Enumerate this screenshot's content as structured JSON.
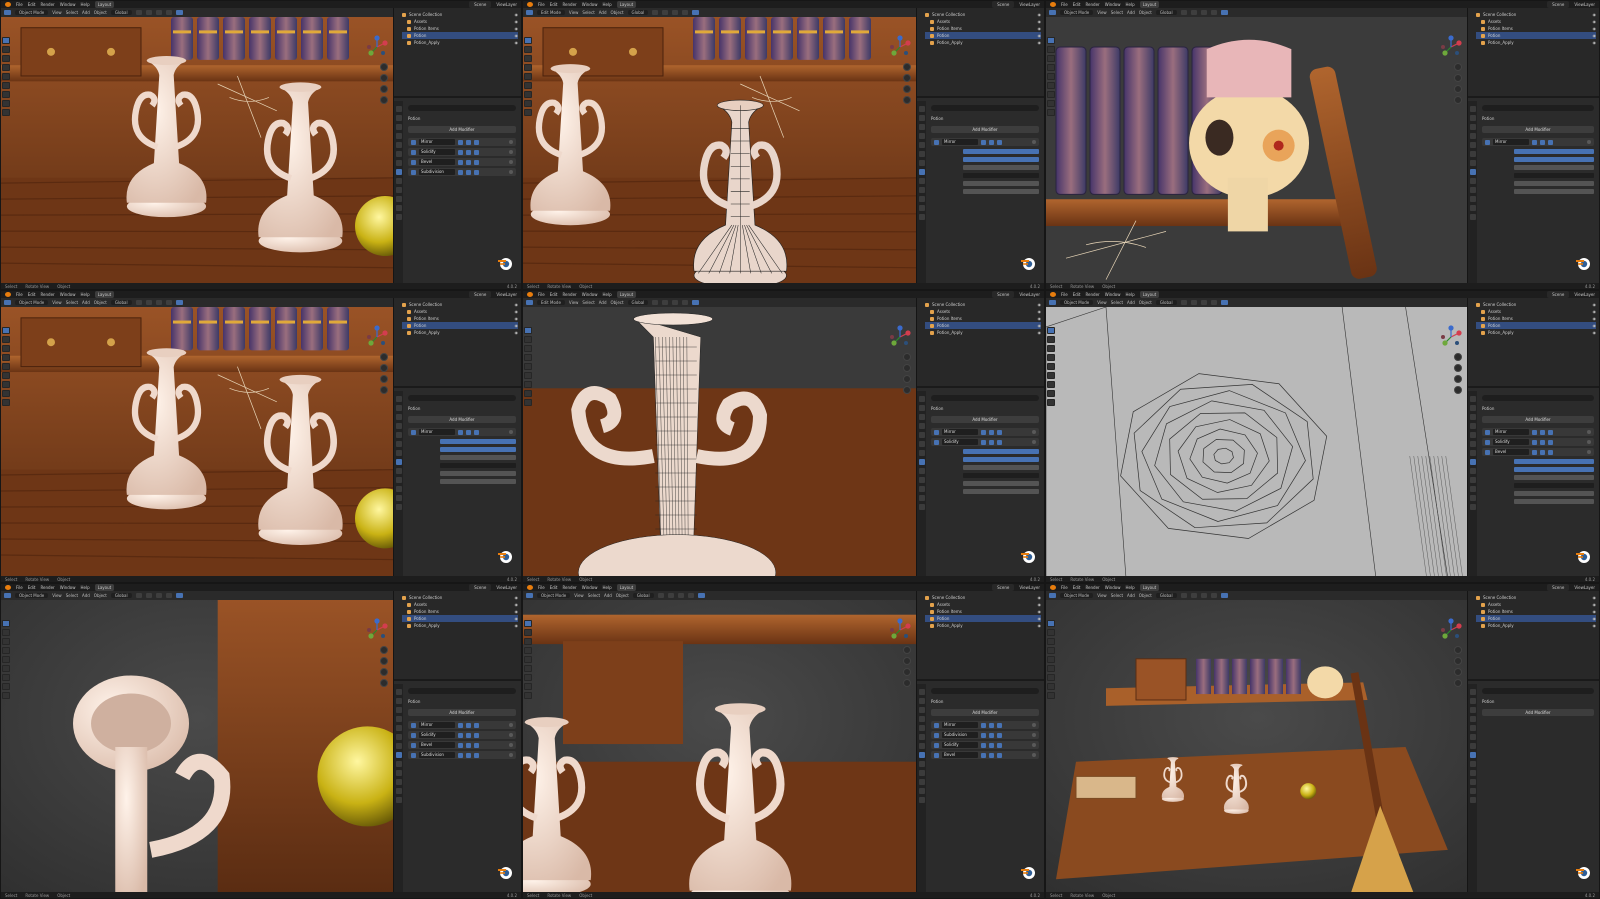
{
  "menus": [
    "File",
    "Edit",
    "Render",
    "Window",
    "Help"
  ],
  "workspace": "Layout",
  "scene_name": "Scene",
  "view_layer": "ViewLayer",
  "editor_labels": {
    "object_mode": "Object Mode",
    "edit_mode": "Edit Mode",
    "view": "View",
    "select": "Select",
    "add": "Add",
    "object": "Object",
    "global": "Global",
    "options": "Options",
    "orientation": "Orientation",
    "default": "Default",
    "drag": "Drag",
    "select_box": "Select Box"
  },
  "status": {
    "select": "Select",
    "rotate_view": "Rotate View",
    "object": "Object",
    "version": "4.0.2"
  },
  "outliner": {
    "items": [
      "Scene Collection",
      "Assets",
      "Potion Items",
      "Potion",
      "Potion_Apply"
    ],
    "selected_index": 3
  },
  "properties": {
    "object_name": "Potion",
    "add_modifier": "Add Modifier"
  },
  "modifier_stacks": [
    [
      "Mirror",
      "Solidify",
      "Bevel",
      "Subdivision"
    ],
    [
      "Mirror"
    ],
    [
      "Mirror"
    ],
    [
      "Mirror"
    ],
    [
      "Mirror",
      "Solidify"
    ],
    [
      "Mirror",
      "Solidify",
      "Bevel"
    ],
    [
      "Mirror",
      "Solidify",
      "Bevel",
      "Subdivision"
    ],
    [
      "Mirror",
      "Subdivision",
      "Solidify",
      "Bevel"
    ],
    []
  ],
  "colors": {
    "accent": "#4772b3",
    "wood": "#8b4a22",
    "wood_dark": "#5b2d13",
    "ceramic": "#f3ddd0",
    "potion_yellow": "#d9c51f",
    "header_bg": "#1d1d1d",
    "panel_bg": "#2b2b2b"
  }
}
